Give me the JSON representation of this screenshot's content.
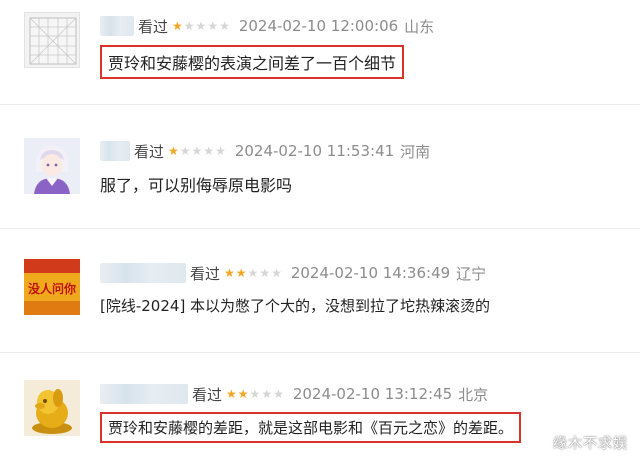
{
  "reviews": [
    {
      "action": "看过",
      "stars_filled": 1,
      "stars_total": 5,
      "date": "2024-02-10 12:00:06",
      "location": "山东",
      "text": "贾玲和安藤樱的表演之间差了一百个细节",
      "highlighted": true,
      "avatar_icon": "chinese-chess-board-avatar"
    },
    {
      "action": "看过",
      "stars_filled": 1,
      "stars_total": 5,
      "date": "2024-02-10 11:53:41",
      "location": "河南",
      "text": "服了，可以别侮辱原电影吗",
      "highlighted": false,
      "avatar_icon": "anime-character-avatar"
    },
    {
      "action": "看过",
      "stars_filled": 2,
      "stars_total": 5,
      "date": "2024-02-10 14:36:49",
      "location": "辽宁",
      "text": "[院线-2024] 本以为憋了个大的，没想到拉了坨热辣滚烫的",
      "highlighted": false,
      "avatar_icon": "text-sign-avatar",
      "avatar_text": "没人问你"
    },
    {
      "action": "看过",
      "stars_filled": 2,
      "stars_total": 5,
      "date": "2024-02-10 13:12:45",
      "location": "北京",
      "text": "贾玲和安藤樱的差距，就是这部电影和《百元之恋》的差距。",
      "highlighted": true,
      "avatar_icon": "golden-figurine-avatar"
    }
  ],
  "watermark": "缘木不求娱",
  "colors": {
    "star_on": "#f5a623",
    "star_off": "#d6d6d6",
    "highlight_border": "#d9342b",
    "meta_gray": "#8c8c8c"
  }
}
